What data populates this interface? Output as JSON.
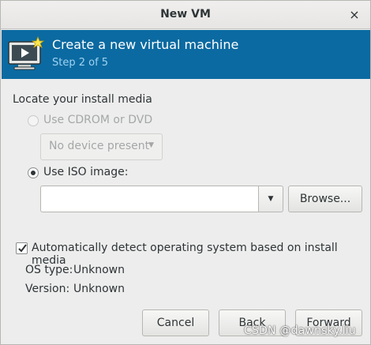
{
  "window": {
    "title": "New VM",
    "close_glyph": "×"
  },
  "banner": {
    "title": "Create a new virtual machine",
    "step": "Step 2 of 5",
    "icon": "virtual-machine-icon",
    "background": "#0b6aa1"
  },
  "section": {
    "label": "Locate your install media"
  },
  "cdrom": {
    "label": "Use CDROM or DVD",
    "selected": false,
    "enabled": false,
    "device_combo": {
      "value": "No device present"
    }
  },
  "iso": {
    "label": "Use ISO image:",
    "selected": true,
    "path_value": "",
    "browse_label": "Browse..."
  },
  "auto_detect": {
    "label": "Automatically detect operating system based on install media",
    "checked": true
  },
  "os_info": {
    "os_type_label": "OS type:",
    "os_type_value": "Unknown",
    "version_label": "Version:",
    "version_value": "Unknown"
  },
  "buttons": {
    "cancel": "Cancel",
    "back": "Back",
    "forward": "Forward"
  },
  "watermark": "CSDN @dawnsky.liu"
}
